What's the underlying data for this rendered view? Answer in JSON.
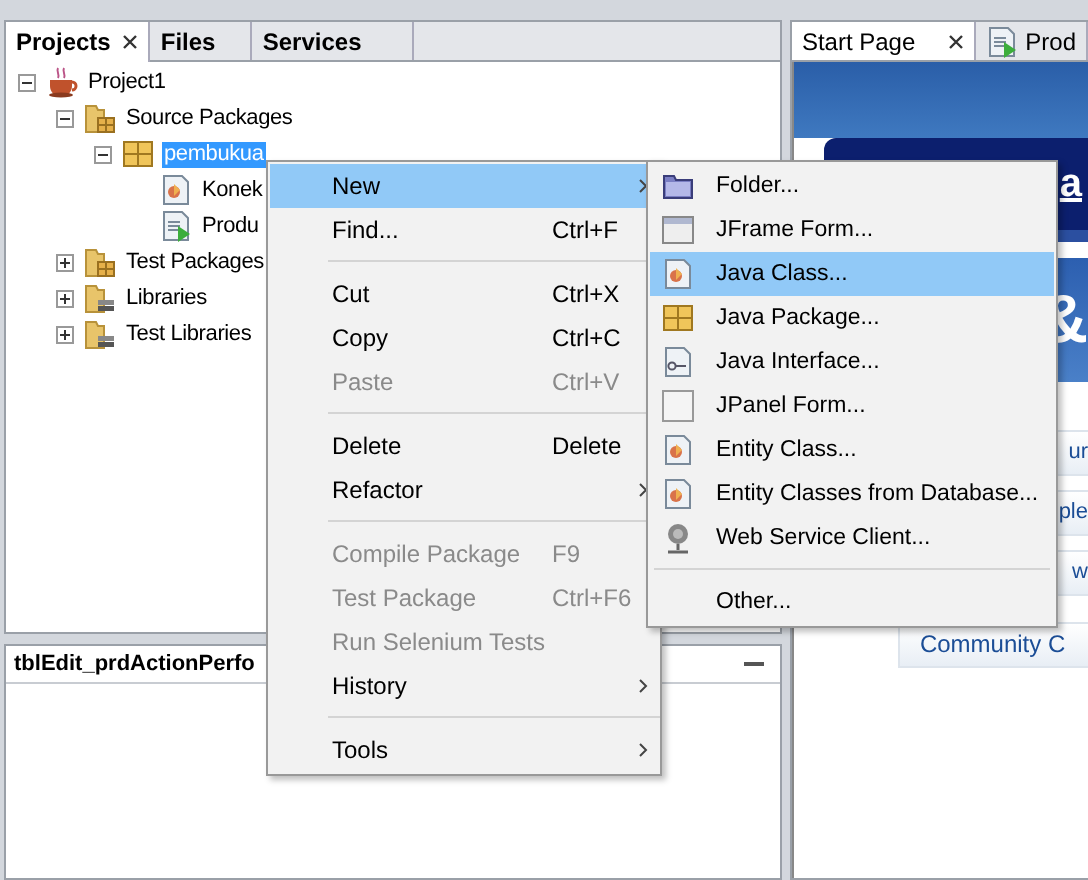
{
  "project_tabs": [
    {
      "label": "Projects",
      "selected": true
    },
    {
      "label": "Files",
      "selected": false
    },
    {
      "label": "Services",
      "selected": false
    }
  ],
  "tree": [
    {
      "label": "Project1",
      "kind": "project",
      "expanded": true,
      "selected": false,
      "children": [
        {
          "label": "Source Packages",
          "kind": "source-folder",
          "expanded": true,
          "selected": false,
          "children": [
            {
              "label": "pembukua",
              "kind": "package",
              "expanded": true,
              "selected": true,
              "children": [
                {
                  "label": "Konek",
                  "kind": "java-class",
                  "selected": false
                },
                {
                  "label": "Produ",
                  "kind": "java-form",
                  "selected": false
                }
              ]
            }
          ]
        },
        {
          "label": "Test Packages",
          "kind": "source-folder",
          "expanded": false,
          "selected": false
        },
        {
          "label": "Libraries",
          "kind": "library",
          "expanded": false,
          "selected": false
        },
        {
          "label": "Test Libraries",
          "kind": "library",
          "expanded": false,
          "selected": false
        }
      ]
    }
  ],
  "navigator": {
    "title": "tblEdit_prdActionPerfo"
  },
  "editor_tabs": [
    {
      "label": "Start Page",
      "selected": true,
      "kind": "page"
    },
    {
      "label": "Prod",
      "selected": false,
      "kind": "java-form"
    }
  ],
  "start_page": {
    "banner_link": "a",
    "headline": "&",
    "links": [
      "ur",
      "ple",
      "w",
      "Community C"
    ]
  },
  "context_menu": [
    {
      "kind": "item",
      "label": "New",
      "submenu": true,
      "selected": true,
      "disabled": false
    },
    {
      "kind": "item",
      "label": "Find...",
      "shortcut": "Ctrl+F",
      "submenu": false,
      "selected": false,
      "disabled": false
    },
    {
      "kind": "separator"
    },
    {
      "kind": "item",
      "label": "Cut",
      "shortcut": "Ctrl+X",
      "submenu": false,
      "selected": false,
      "disabled": false
    },
    {
      "kind": "item",
      "label": "Copy",
      "shortcut": "Ctrl+C",
      "submenu": false,
      "selected": false,
      "disabled": false
    },
    {
      "kind": "item",
      "label": "Paste",
      "shortcut": "Ctrl+V",
      "submenu": false,
      "selected": false,
      "disabled": true
    },
    {
      "kind": "separator"
    },
    {
      "kind": "item",
      "label": "Delete",
      "shortcut": "Delete",
      "submenu": false,
      "selected": false,
      "disabled": false
    },
    {
      "kind": "item",
      "label": "Refactor",
      "submenu": true,
      "selected": false,
      "disabled": false
    },
    {
      "kind": "separator"
    },
    {
      "kind": "item",
      "label": "Compile Package",
      "shortcut": "F9",
      "submenu": false,
      "selected": false,
      "disabled": true
    },
    {
      "kind": "item",
      "label": "Test Package",
      "shortcut": "Ctrl+F6",
      "submenu": false,
      "selected": false,
      "disabled": true
    },
    {
      "kind": "item",
      "label": "Run Selenium Tests",
      "submenu": false,
      "selected": false,
      "disabled": true
    },
    {
      "kind": "item",
      "label": "History",
      "submenu": true,
      "selected": false,
      "disabled": false
    },
    {
      "kind": "separator"
    },
    {
      "kind": "item",
      "label": "Tools",
      "submenu": true,
      "selected": false,
      "disabled": false
    }
  ],
  "new_submenu": [
    {
      "kind": "folder",
      "label": "Folder...",
      "selected": false
    },
    {
      "kind": "frame",
      "label": "JFrame Form...",
      "selected": false
    },
    {
      "kind": "java-class",
      "label": "Java Class...",
      "selected": true
    },
    {
      "kind": "package",
      "label": "Java Package...",
      "selected": false
    },
    {
      "kind": "interface",
      "label": "Java Interface...",
      "selected": false
    },
    {
      "kind": "panel",
      "label": "JPanel Form...",
      "selected": false
    },
    {
      "kind": "java-class",
      "label": "Entity Class...",
      "selected": false
    },
    {
      "kind": "java-class",
      "label": "Entity Classes from Database...",
      "selected": false
    },
    {
      "kind": "web-service",
      "label": "Web Service Client...",
      "selected": false
    },
    {
      "kind": "separator"
    },
    {
      "kind": "plain",
      "label": "Other...",
      "selected": false
    }
  ]
}
